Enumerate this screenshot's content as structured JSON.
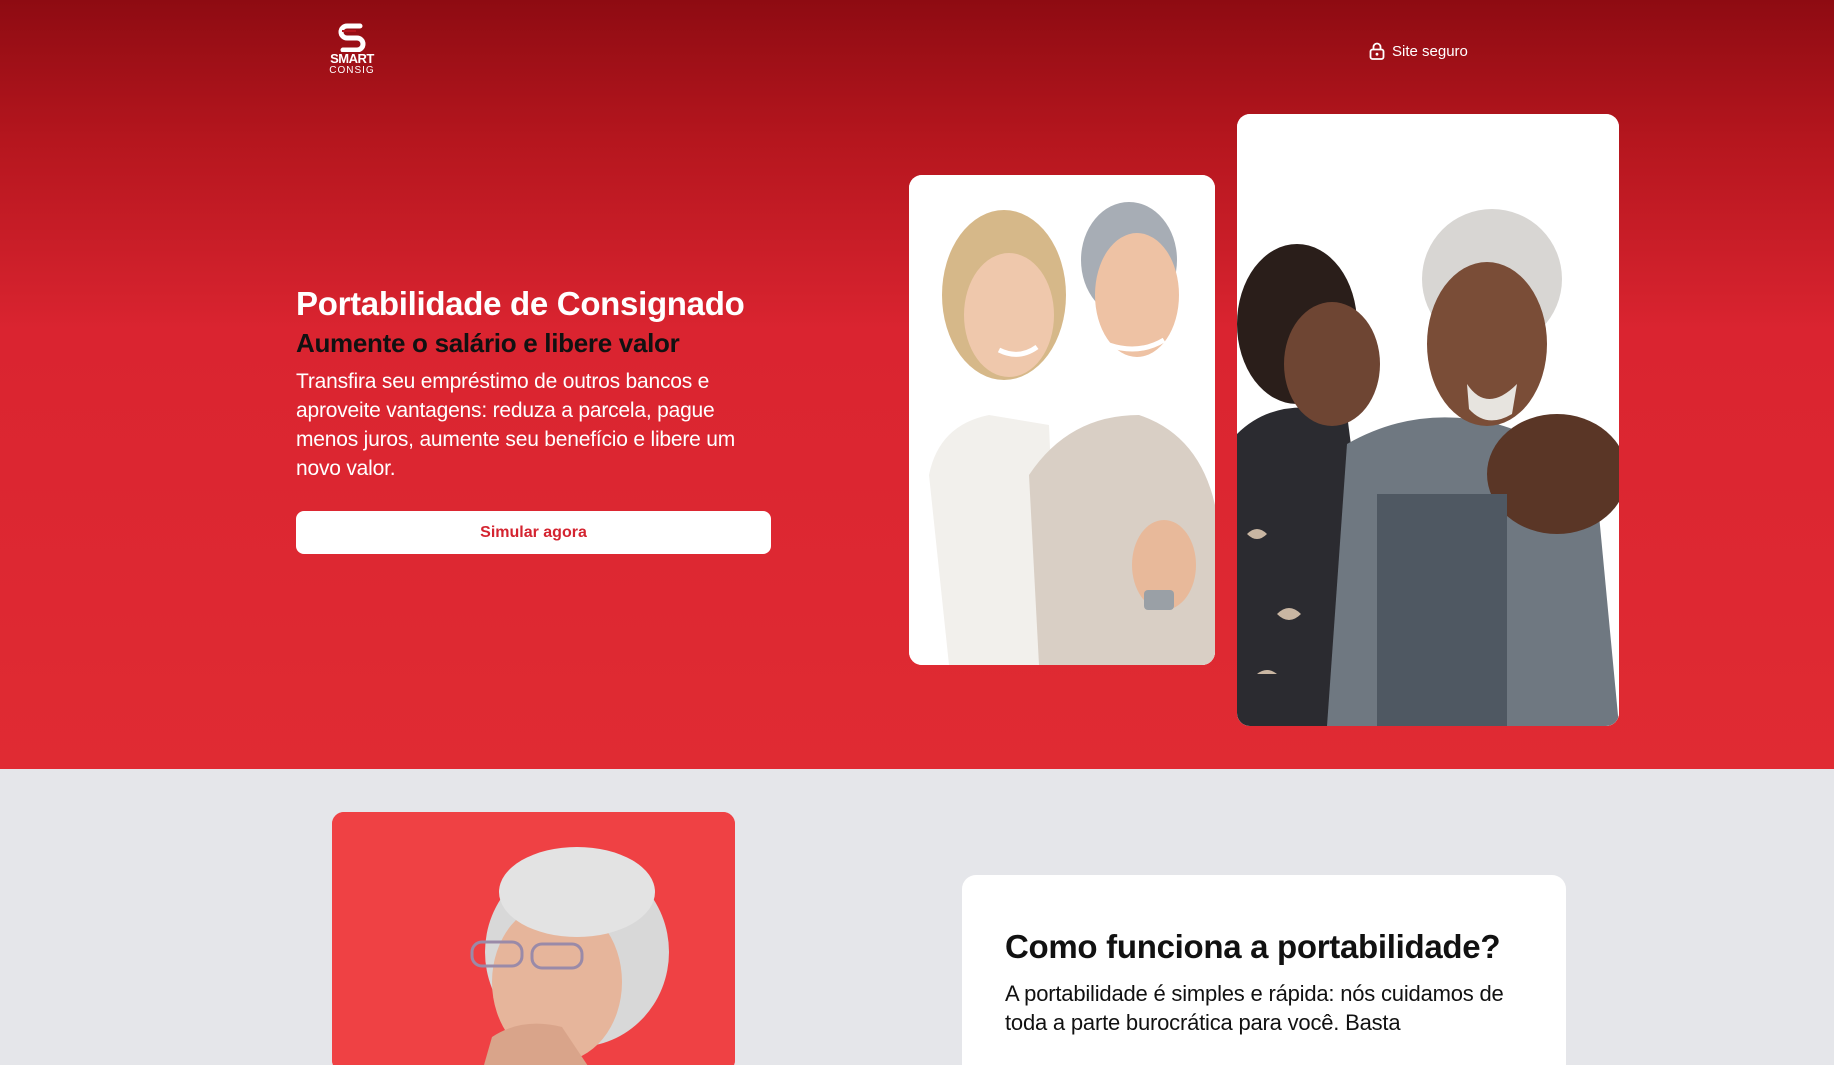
{
  "header": {
    "logo_word_1": "SMART",
    "logo_word_2": "CONSIG",
    "secure_label": "Site seguro",
    "secure_icon": "lock-icon"
  },
  "hero": {
    "title": "Portabilidade de Consignado",
    "subtitle": "Aumente o salário e libere valor",
    "description": "Transfira seu empréstimo de outros bancos e aproveite vantagens: reduza a parcela, pague menos juros, aumente seu benefício e libere um novo valor.",
    "cta_label": "Simular agora"
  },
  "how_it_works": {
    "title": "Como funciona a portabilidade?",
    "text": "A portabilidade é simples e rápida: nós cuidamos de toda a parte burocrática para você. Basta"
  },
  "colors": {
    "brand_red": "#e02b33",
    "brand_dark_red": "#8e0b12",
    "card_red": "#ef4144",
    "section_bg": "#e5e6ea"
  }
}
